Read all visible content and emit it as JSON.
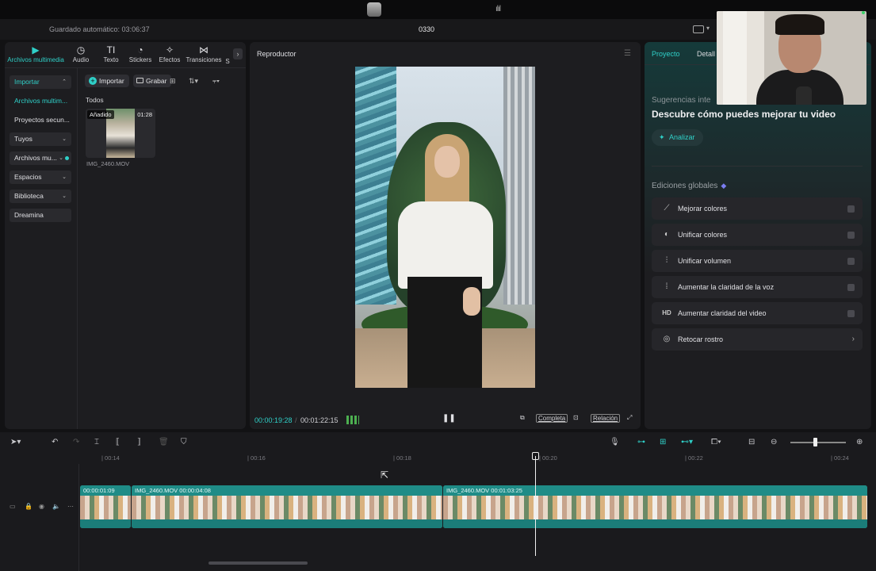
{
  "titlebar": {
    "autosave": "Guardado automático: 03:06:37",
    "project_name": "0330"
  },
  "left_panel": {
    "tabs": [
      {
        "label": "Archivos multimedia",
        "icon": "media-icon",
        "glyph": "▶"
      },
      {
        "label": "Audio",
        "icon": "audio-icon",
        "glyph": "◷"
      },
      {
        "label": "Texto",
        "icon": "text-icon",
        "glyph": "TI"
      },
      {
        "label": "Stickers",
        "icon": "sticker-icon",
        "glyph": "◔"
      },
      {
        "label": "Efectos",
        "icon": "effects-icon",
        "glyph": "✧"
      },
      {
        "label": "Transiciones",
        "icon": "transitions-icon",
        "glyph": "⋈"
      },
      {
        "label": "S",
        "icon": "more-icon",
        "glyph": ""
      }
    ],
    "nav": {
      "import": "Importar",
      "media": "Archivos multim...",
      "secondary": "Proyectos secun...",
      "yours": "Tuyos",
      "media2": "Archivos mu...",
      "spaces": "Espacios",
      "library": "Biblioteca",
      "dreamina": "Dreamina"
    },
    "import_button": "Importar",
    "record_button": "Grabar",
    "section_label": "Todos",
    "media_item": {
      "badge": "Añadido",
      "duration": "01:28",
      "filename": "IMG_2460.MOV"
    }
  },
  "player": {
    "title": "Reproductor",
    "current_time": "00:00:19:28",
    "total_time": "00:01:22:15",
    "full_label": "Completa",
    "ratio_label": "Relación"
  },
  "right_panel": {
    "tabs": [
      "Proyecto",
      "Detall"
    ],
    "suggestions_label": "Sugerencias inte",
    "suggestions_heading": "Descubre cómo puedes mejorar tu video",
    "analyze_button": "Analizar",
    "global_edits_label": "Ediciones globales",
    "global_edits": [
      {
        "label": "Mejorar colores",
        "icon": "magic-wand-icon",
        "glyph": "⟋"
      },
      {
        "label": "Unificar colores",
        "icon": "color-match-icon",
        "glyph": "◐"
      },
      {
        "label": "Unificar volumen",
        "icon": "volume-sliders-icon",
        "glyph": "⫶"
      },
      {
        "label": "Aumentar la claridad de la voz",
        "icon": "voice-wave-icon",
        "glyph": "⁞"
      },
      {
        "label": "Aumentar claridad del video",
        "icon": "hd-icon",
        "glyph": "HD"
      },
      {
        "label": "Retocar rostro",
        "icon": "face-retouch-icon",
        "glyph": "◎"
      }
    ]
  },
  "timeline": {
    "ruler": [
      "| 00:14",
      "| 00:16",
      "| 00:18",
      "| 00:20",
      "| 00:22",
      "| 00:24"
    ],
    "clips": [
      {
        "name": "",
        "duration": "00:00:01:09"
      },
      {
        "name": "IMG_2460.MOV",
        "duration": "00:00:04:08"
      },
      {
        "name": "IMG_2460.MOV",
        "duration": "00:01:03:25"
      }
    ]
  }
}
